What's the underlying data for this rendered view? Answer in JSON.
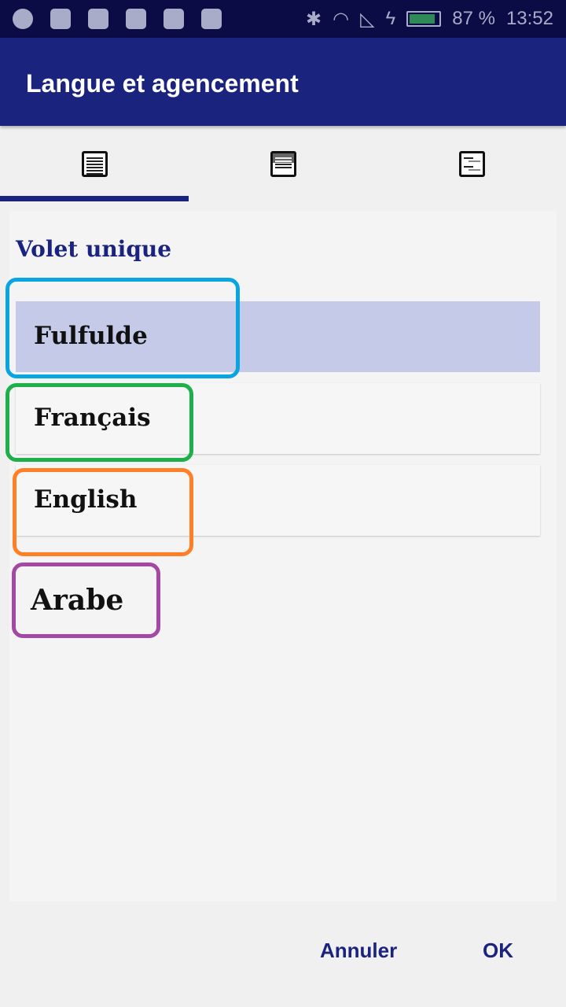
{
  "status_bar": {
    "battery": "87 %",
    "time": "13:52",
    "battery_level": 0.87,
    "battery_color": "#2e8b57",
    "icons": [
      "app-icon",
      "image-icon",
      "play-shield-icon",
      "gmail-icon",
      "sync-icon",
      "android-icon",
      "bluetooth-icon",
      "wifi-icon",
      "signal-icon",
      "charging-icon",
      "battery-icon"
    ]
  },
  "app_bar": {
    "title": "Langue et agencement",
    "color": "#1a237e"
  },
  "tabs": [
    {
      "icon": "single-pane-icon",
      "active": true
    },
    {
      "icon": "two-pane-icon",
      "active": false
    },
    {
      "icon": "interlinear-icon",
      "active": false
    }
  ],
  "section": {
    "title": "Volet unique"
  },
  "languages": [
    {
      "label": "Fulfulde",
      "selected": true
    },
    {
      "label": "Français"
    },
    {
      "label": "English"
    },
    {
      "label": "Arabe"
    }
  ],
  "annotation_colors": [
    "#0aa5e0",
    "#1db04a",
    "#ff7f27",
    "#a349a4"
  ],
  "buttons": {
    "cancel": "Annuler",
    "ok": "OK"
  }
}
